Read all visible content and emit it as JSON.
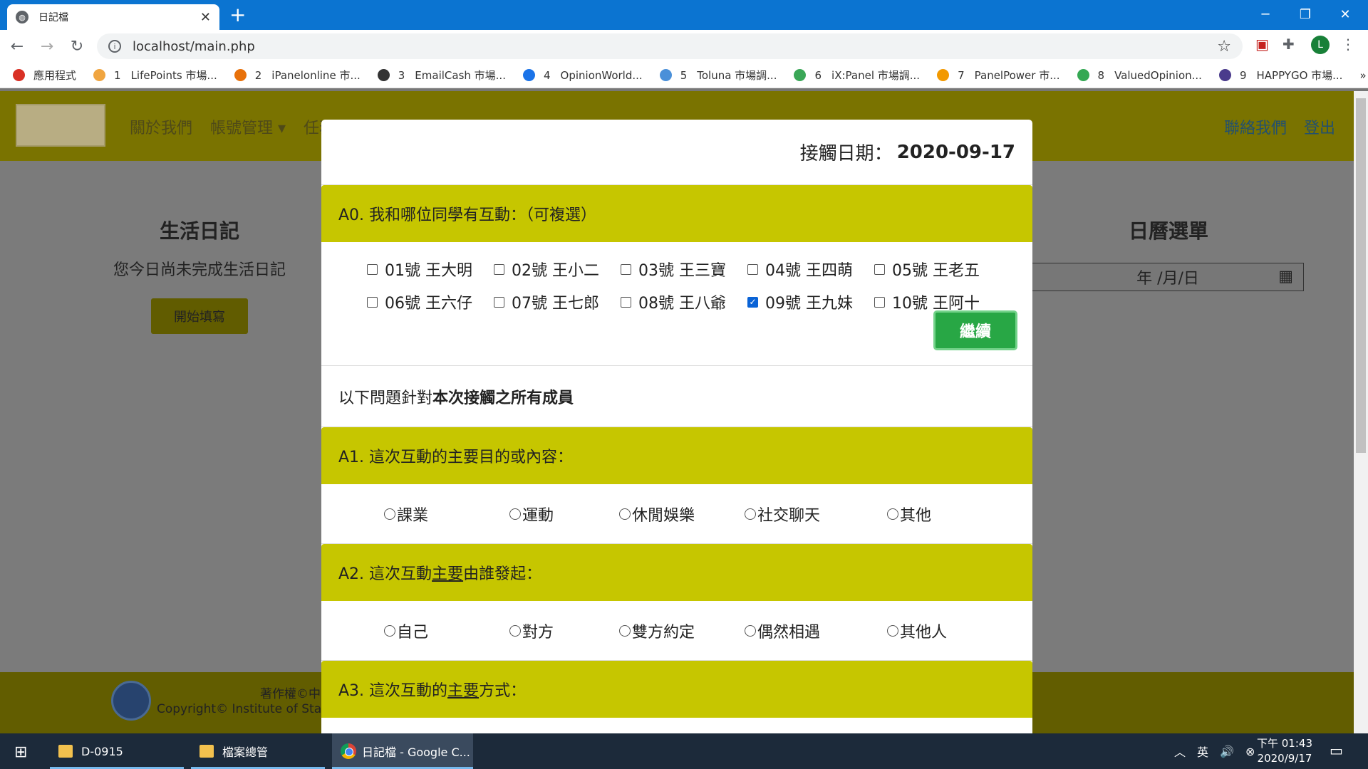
{
  "browser": {
    "tab_title": "日記檔",
    "tab_close": "✕",
    "new_tab": "+",
    "url": "localhost/main.php",
    "window_controls": {
      "minimize": "─",
      "restore": "❐",
      "close": "✕"
    },
    "bookmarks": [
      {
        "label": "應用程式",
        "num": "",
        "color": "#d93025"
      },
      {
        "label": "LifePoints 市場...",
        "num": "1",
        "color": "#f0a540"
      },
      {
        "label": "iPanelonline 市...",
        "num": "2",
        "color": "#e8710a"
      },
      {
        "label": "EmailCash 市場...",
        "num": "3",
        "color": "#333333"
      },
      {
        "label": "OpinionWorld...",
        "num": "4",
        "color": "#1a73e8"
      },
      {
        "label": "Toluna 市場調...",
        "num": "5",
        "color": "#4a90d9"
      },
      {
        "label": "iX:Panel 市場調...",
        "num": "6",
        "color": "#3aa757"
      },
      {
        "label": "PanelPower 市...",
        "num": "7",
        "color": "#f29900"
      },
      {
        "label": "ValuedOpinion...",
        "num": "8",
        "color": "#34a853"
      },
      {
        "label": "HAPPYGO 市場...",
        "num": "9",
        "color": "#4a3b8c"
      }
    ],
    "bookmarks_more": "»",
    "avatar_letter": "L"
  },
  "site": {
    "nav": {
      "about": "關於我們",
      "account": "帳號管理 ▾",
      "partial": "任務專區　相關資訊",
      "contact": "聯絡我們",
      "logout": "登出"
    },
    "left": {
      "title": "生活日記",
      "status": "您今日尚未完成生活日記",
      "start_button": "開始填寫"
    },
    "right": {
      "title": "日曆選單",
      "date_placeholder": "年 /月/日"
    },
    "footer": {
      "line1": "著作權©中",
      "line2": "Copyright© Institute of Statis"
    }
  },
  "modal": {
    "date_label": "接觸日期：",
    "date_value": "2020-09-17",
    "a0": {
      "question": "A0. 我和哪位同學有互動：（可複選）",
      "students": [
        {
          "label": "01號 王大明",
          "checked": false
        },
        {
          "label": "02號 王小二",
          "checked": false
        },
        {
          "label": "03號 王三寶",
          "checked": false
        },
        {
          "label": "04號 王四萌",
          "checked": false
        },
        {
          "label": "05號 王老五",
          "checked": false
        },
        {
          "label": "06號 王六仔",
          "checked": false
        },
        {
          "label": "07號 王七郎",
          "checked": false
        },
        {
          "label": "08號 王八爺",
          "checked": false
        },
        {
          "label": "09號 王九妹",
          "checked": true
        },
        {
          "label": "10號 王阿十",
          "checked": false
        }
      ],
      "continue_button": "繼續"
    },
    "note_prefix": "以下問題針對",
    "note_bold": "本次接觸之所有成員",
    "a1": {
      "question": "A1. 這次互動的主要目的或內容：",
      "options": [
        "課業",
        "運動",
        "休閒娛樂",
        "社交聊天",
        "其他"
      ]
    },
    "a2": {
      "q_prefix": "A2. 這次互動",
      "q_underline": "主要",
      "q_suffix": "由誰發起：",
      "options": [
        "自己",
        "對方",
        "雙方約定",
        "偶然相遇",
        "其他人"
      ]
    },
    "a3": {
      "q_prefix": "A3. 這次互動的",
      "q_underline": "主要",
      "q_suffix": "方式："
    }
  },
  "taskbar": {
    "items": [
      {
        "label": "D-0915"
      },
      {
        "label": "檔案總管"
      },
      {
        "label": "日記檔 - Google C..."
      }
    ],
    "tray": {
      "ime": "英",
      "volume": "🔊",
      "clock_time": "下午 01:43",
      "clock_date": "2020/9/17"
    }
  }
}
